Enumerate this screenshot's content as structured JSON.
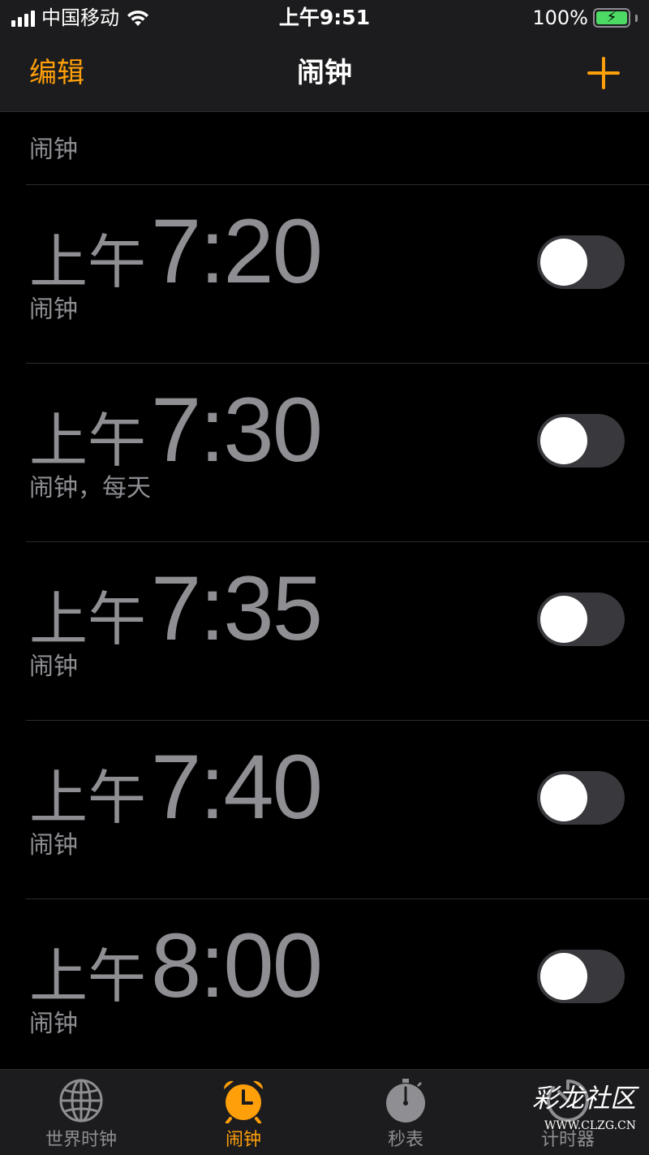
{
  "status_bar": {
    "carrier": "中国移动",
    "time": "上午9:51",
    "battery": "100%",
    "battery_level": 1.0
  },
  "nav": {
    "edit_label": "编辑",
    "title": "闹钟",
    "add_icon": "plus-icon",
    "accent_color": "#ff9f0a"
  },
  "alarms": {
    "partial_top": {
      "label": "闹钟"
    },
    "items": [
      {
        "ampm": "上午",
        "time": "7:20",
        "label": "闹钟",
        "enabled": false
      },
      {
        "ampm": "上午",
        "time": "7:30",
        "label": "闹钟，每天",
        "enabled": false
      },
      {
        "ampm": "上午",
        "time": "7:35",
        "label": "闹钟",
        "enabled": false
      },
      {
        "ampm": "上午",
        "time": "7:40",
        "label": "闹钟",
        "enabled": false
      },
      {
        "ampm": "上午",
        "time": "8:00",
        "label": "闹钟",
        "enabled": false
      }
    ]
  },
  "tabs": [
    {
      "label": "世界时钟",
      "icon": "globe-icon",
      "active": false
    },
    {
      "label": "闹钟",
      "icon": "alarm-clock-icon",
      "active": true
    },
    {
      "label": "秒表",
      "icon": "stopwatch-icon",
      "active": false
    },
    {
      "label": "计时器",
      "icon": "timer-icon",
      "active": false
    }
  ],
  "watermark": {
    "text": "彩龙社区",
    "url": "WWW.CLZG.CN"
  }
}
